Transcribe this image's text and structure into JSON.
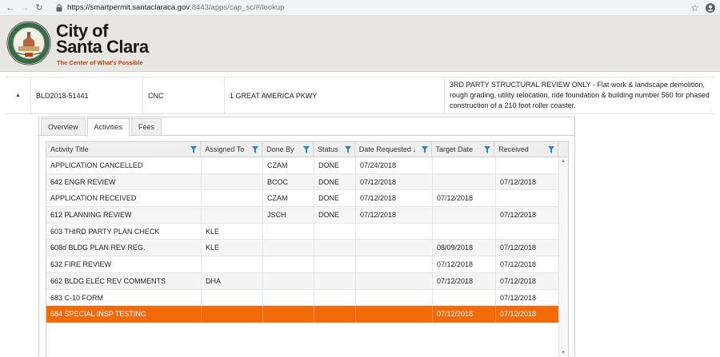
{
  "browser": {
    "url_host": "https://smartpermit.santaclaraca.gov",
    "url_rest": ":8443/apps/cap_sc/#/lookup"
  },
  "brand": {
    "line1": "City of",
    "line2": "Santa Clara",
    "tagline": "The Center of What's Possible",
    "accent": "#c2410c"
  },
  "record": {
    "number": "BLD2018-51441",
    "type": "CNC",
    "address": "1 GREAT AMERICA PKWY",
    "description": "3RD PARTY STRUCTURAL REVIEW ONLY - Flat work & landscape demolition, rough grading, utility relocation, ride foundation & building number 560 for phased construction of a 210 foot roller coaster."
  },
  "tabs": [
    {
      "label": "Overview"
    },
    {
      "label": "Activities"
    },
    {
      "label": "Fees"
    }
  ],
  "grid": {
    "columns": [
      "Activity Title",
      "Assigned To",
      "Done By",
      "Status",
      "Date Requested",
      "Target Date",
      "Received"
    ],
    "sort_arrow": "↓",
    "selected_color": "#f26a0a",
    "rows": [
      [
        "APPLICATION CANCELLED",
        "",
        "CZAM",
        "DONE",
        "07/24/2018",
        "",
        ""
      ],
      [
        "642 ENGR REVIEW",
        "",
        "BCOC",
        "DONE",
        "07/12/2018",
        "",
        "07/12/2018"
      ],
      [
        "APPLICATION RECEIVED",
        "",
        "CZAM",
        "DONE",
        "07/12/2018",
        "07/12/2018",
        ""
      ],
      [
        "612 PLANNING REVIEW",
        "",
        "JSCH",
        "DONE",
        "07/12/2018",
        "",
        "07/12/2018"
      ],
      [
        "603 THIRD PARTY PLAN CHECK",
        "KLE",
        "",
        "",
        "",
        "",
        ""
      ],
      [
        "608d BLDG PLAN REV REG.",
        "KLE",
        "",
        "",
        "",
        "08/09/2018",
        "07/12/2018"
      ],
      [
        "632 FIRE REVIEW",
        "",
        "",
        "",
        "",
        "07/12/2018",
        "07/12/2018"
      ],
      [
        "662 BLDG ELEC REV COMMENTS",
        "DHA",
        "",
        "",
        "",
        "07/12/2018",
        "07/12/2018"
      ],
      [
        "683 C-10 FORM",
        "",
        "",
        "",
        "",
        "",
        "07/12/2018"
      ],
      [
        "684 SPECIAL INSP TESTING",
        "",
        "",
        "",
        "",
        "07/12/2018",
        "07/12/2018"
      ]
    ]
  }
}
